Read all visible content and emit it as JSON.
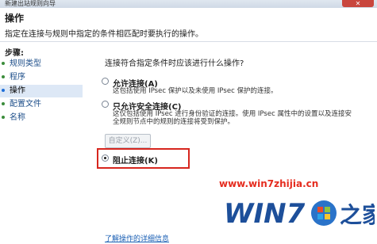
{
  "window": {
    "title": "新建出站规则向导",
    "close_label": "✕"
  },
  "header": {
    "title": "操作",
    "description": "指定在连接与规则中指定的条件相匹配时要执行的操作。"
  },
  "sidebar": {
    "title": "步骤:",
    "items": [
      {
        "label": "规则类型",
        "active": false
      },
      {
        "label": "程序",
        "active": false
      },
      {
        "label": "操作",
        "active": true
      },
      {
        "label": "配置文件",
        "active": false
      },
      {
        "label": "名称",
        "active": false
      }
    ]
  },
  "main": {
    "question": "连接符合指定条件时应该进行什么操作?",
    "options": [
      {
        "label": "允许连接(A)",
        "desc": [
          "这包括使用 IPsec 保护以及未使用 IPsec 保护的连接。"
        ],
        "checked": false
      },
      {
        "label": "只允许安全连接(C)",
        "desc": [
          "这仅包括使用 IPsec 进行身份验证的连接。使用 IPsec 属性中的设置以及连接安",
          "全规则节点中的规则的连接将受到保护。"
        ],
        "checked": false
      },
      {
        "label": "阻止连接(K)",
        "desc": [],
        "checked": true
      }
    ],
    "custom_button": "自定义(Z)...",
    "learn_link": "了解操作的详细信息"
  },
  "watermark": {
    "url": "www.win7zhijia.cn",
    "logo_text": "WIN7",
    "logo_suffix": "之家"
  },
  "colors": {
    "accent_red": "#d7261e",
    "link": "#1a5fb4",
    "logo_blue": "#1d4f9a"
  }
}
